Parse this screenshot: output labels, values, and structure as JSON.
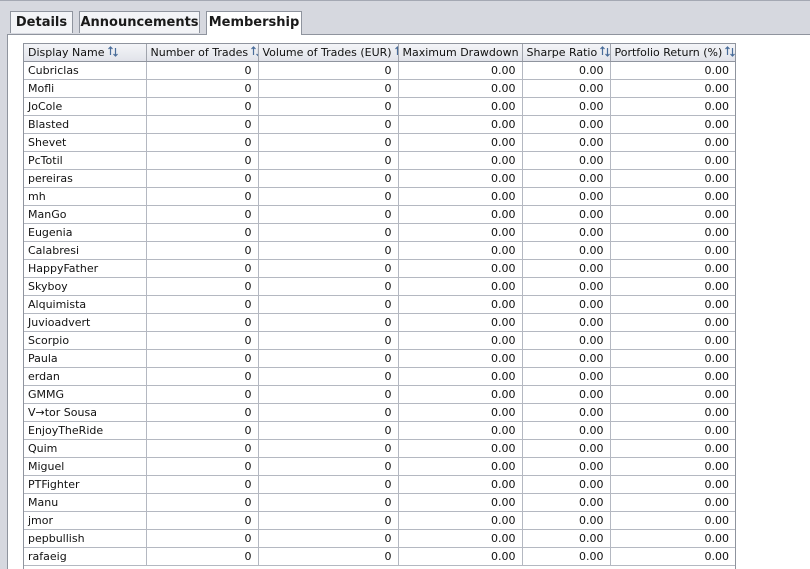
{
  "tabs": [
    {
      "label": "Details",
      "active": false
    },
    {
      "label": "Announcements",
      "active": false
    },
    {
      "label": "Membership",
      "active": true
    }
  ],
  "table": {
    "sort_icon": "sort-arrows-icon",
    "columns": [
      {
        "label": "Display Name",
        "align": "left"
      },
      {
        "label": "Number of Trades",
        "align": "right"
      },
      {
        "label": "Volume of Trades (EUR)",
        "align": "right"
      },
      {
        "label": "Maximum Drawdown",
        "align": "right"
      },
      {
        "label": "Sharpe Ratio",
        "align": "right"
      },
      {
        "label": "Portfolio Return (%)",
        "align": "right"
      }
    ],
    "rows": [
      [
        "Cubriclas",
        "0",
        "0",
        "0.00",
        "0.00",
        "0.00"
      ],
      [
        "Mofli",
        "0",
        "0",
        "0.00",
        "0.00",
        "0.00"
      ],
      [
        "JoCole",
        "0",
        "0",
        "0.00",
        "0.00",
        "0.00"
      ],
      [
        "Blasted",
        "0",
        "0",
        "0.00",
        "0.00",
        "0.00"
      ],
      [
        "Shevet",
        "0",
        "0",
        "0.00",
        "0.00",
        "0.00"
      ],
      [
        "PcTotil",
        "0",
        "0",
        "0.00",
        "0.00",
        "0.00"
      ],
      [
        "pereiras",
        "0",
        "0",
        "0.00",
        "0.00",
        "0.00"
      ],
      [
        "mh",
        "0",
        "0",
        "0.00",
        "0.00",
        "0.00"
      ],
      [
        "ManGo",
        "0",
        "0",
        "0.00",
        "0.00",
        "0.00"
      ],
      [
        "Eugenia",
        "0",
        "0",
        "0.00",
        "0.00",
        "0.00"
      ],
      [
        "Calabresi",
        "0",
        "0",
        "0.00",
        "0.00",
        "0.00"
      ],
      [
        "HappyFather",
        "0",
        "0",
        "0.00",
        "0.00",
        "0.00"
      ],
      [
        "Skyboy",
        "0",
        "0",
        "0.00",
        "0.00",
        "0.00"
      ],
      [
        "Alquimista",
        "0",
        "0",
        "0.00",
        "0.00",
        "0.00"
      ],
      [
        "Juvioadvert",
        "0",
        "0",
        "0.00",
        "0.00",
        "0.00"
      ],
      [
        "Scorpio",
        "0",
        "0",
        "0.00",
        "0.00",
        "0.00"
      ],
      [
        "Paula",
        "0",
        "0",
        "0.00",
        "0.00",
        "0.00"
      ],
      [
        "erdan",
        "0",
        "0",
        "0.00",
        "0.00",
        "0.00"
      ],
      [
        "GMMG",
        "0",
        "0",
        "0.00",
        "0.00",
        "0.00"
      ],
      [
        "V→tor Sousa",
        "0",
        "0",
        "0.00",
        "0.00",
        "0.00"
      ],
      [
        "EnjoyTheRide",
        "0",
        "0",
        "0.00",
        "0.00",
        "0.00"
      ],
      [
        "Quim",
        "0",
        "0",
        "0.00",
        "0.00",
        "0.00"
      ],
      [
        "Miguel",
        "0",
        "0",
        "0.00",
        "0.00",
        "0.00"
      ],
      [
        "PTFighter",
        "0",
        "0",
        "0.00",
        "0.00",
        "0.00"
      ],
      [
        "Manu",
        "0",
        "0",
        "0.00",
        "0.00",
        "0.00"
      ],
      [
        "jmor",
        "0",
        "0",
        "0.00",
        "0.00",
        "0.00"
      ],
      [
        "pepbullish",
        "0",
        "0",
        "0.00",
        "0.00",
        "0.00"
      ],
      [
        "rafaeig",
        "0",
        "0",
        "0.00",
        "0.00",
        "0.00"
      ]
    ]
  }
}
